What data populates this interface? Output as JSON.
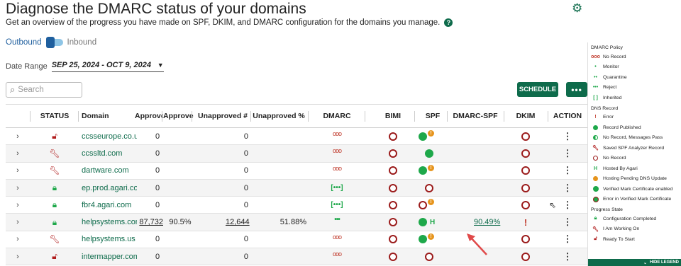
{
  "header": {
    "title": "Diagnose the DMARC status of your domains",
    "subtitle": "Get an overview of the progress you have made on SPF, DKIM, and DMARC configuration for the domains you manage."
  },
  "toggle": {
    "left_label": "Outbound",
    "right_label": "Inbound",
    "selected": "Outbound"
  },
  "date_range": {
    "label": "Date Range",
    "value": "SEP 25, 2024 - OCT 9, 2024"
  },
  "search": {
    "placeholder": "Search"
  },
  "toolbar": {
    "schedule_label": "SCHEDULE",
    "more_label": "•••"
  },
  "table": {
    "columns": [
      "STATUS",
      "Domain",
      "Approve",
      "Approve",
      "Unapproved #",
      "Unapproved %",
      "DMARC",
      "BIMI",
      "SPF",
      "DMARC-SPF",
      "DKIM",
      "ACTION"
    ],
    "rows": [
      {
        "status": "ready-to-start",
        "domain": "ccsseurope.co.uk",
        "approved": "0",
        "approved_pct": "",
        "unapproved": "0",
        "unapproved_pct": "",
        "dmarc": "no-record",
        "bimi": "no-record",
        "spf": "published-pending",
        "dmarc_spf": "",
        "dkim": "no-record"
      },
      {
        "status": "working-on",
        "domain": "ccssltd.com",
        "approved": "0",
        "approved_pct": "",
        "unapproved": "0",
        "unapproved_pct": "",
        "dmarc": "no-record",
        "bimi": "no-record",
        "spf": "published",
        "dmarc_spf": "",
        "dkim": "no-record"
      },
      {
        "status": "working-on",
        "domain": "dartware.com",
        "approved": "0",
        "approved_pct": "",
        "unapproved": "0",
        "unapproved_pct": "",
        "dmarc": "no-record",
        "bimi": "no-record",
        "spf": "published-pending",
        "dmarc_spf": "",
        "dkim": "no-record"
      },
      {
        "status": "completed",
        "domain": "ep.prod.agari.com",
        "approved": "0",
        "approved_pct": "",
        "unapproved": "0",
        "unapproved_pct": "",
        "dmarc": "inherited",
        "bimi": "no-record",
        "spf": "no-record",
        "dmarc_spf": "",
        "dkim": "no-record"
      },
      {
        "status": "completed",
        "domain": "fbr4.agari.com",
        "approved": "0",
        "approved_pct": "",
        "unapproved": "0",
        "unapproved_pct": "",
        "dmarc": "inherited",
        "bimi": "no-record",
        "spf": "no-record-pending",
        "dmarc_spf": "",
        "dkim": "no-record"
      },
      {
        "status": "completed",
        "domain": "helpsystems.com",
        "approved": "87,732",
        "approved_pct": "90.5%",
        "unapproved": "12,644",
        "unapproved_pct": "51.88%",
        "dmarc": "reject",
        "bimi": "no-record",
        "spf": "published-hosted",
        "dmarc_spf": "90.49%",
        "dkim": "error"
      },
      {
        "status": "working-on",
        "domain": "helpsystems.us",
        "approved": "0",
        "approved_pct": "",
        "unapproved": "0",
        "unapproved_pct": "",
        "dmarc": "no-record",
        "bimi": "no-record",
        "spf": "published-pending",
        "dmarc_spf": "",
        "dkim": "no-record"
      },
      {
        "status": "ready-to-start",
        "domain": "intermapper.com",
        "approved": "0",
        "approved_pct": "",
        "unapproved": "0",
        "unapproved_pct": "",
        "dmarc": "no-record",
        "bimi": "no-record",
        "spf": "no-record",
        "dmarc_spf": "",
        "dkim": "no-record"
      }
    ]
  },
  "legend": {
    "dmarc_policy_title": "DMARC Policy",
    "dmarc_policy": [
      "No Record",
      "Monitor",
      "Quarantine",
      "Reject",
      "Inherited"
    ],
    "dns_record_title": "DNS Record",
    "dns_record": [
      "Error",
      "Record Published",
      "No Record, Messages Pass",
      "Saved SPF Analyzer Record",
      "No Record",
      "Hosted By Agari",
      "Hosting Pending DNS Update",
      "Verified Mark Certificate enabled",
      "Error in Verified Mark Certificate"
    ],
    "progress_state_title": "Progress State",
    "progress_state": [
      "Configuration Completed",
      "I Am Working On",
      "Ready To Start"
    ],
    "hide_label": "HIDE LEGEND"
  },
  "colors": {
    "brand_green": "#0e6b4b",
    "ok_green": "#1ea84a",
    "error_red": "#9b1b1b",
    "pending_orange": "#e6941c"
  }
}
